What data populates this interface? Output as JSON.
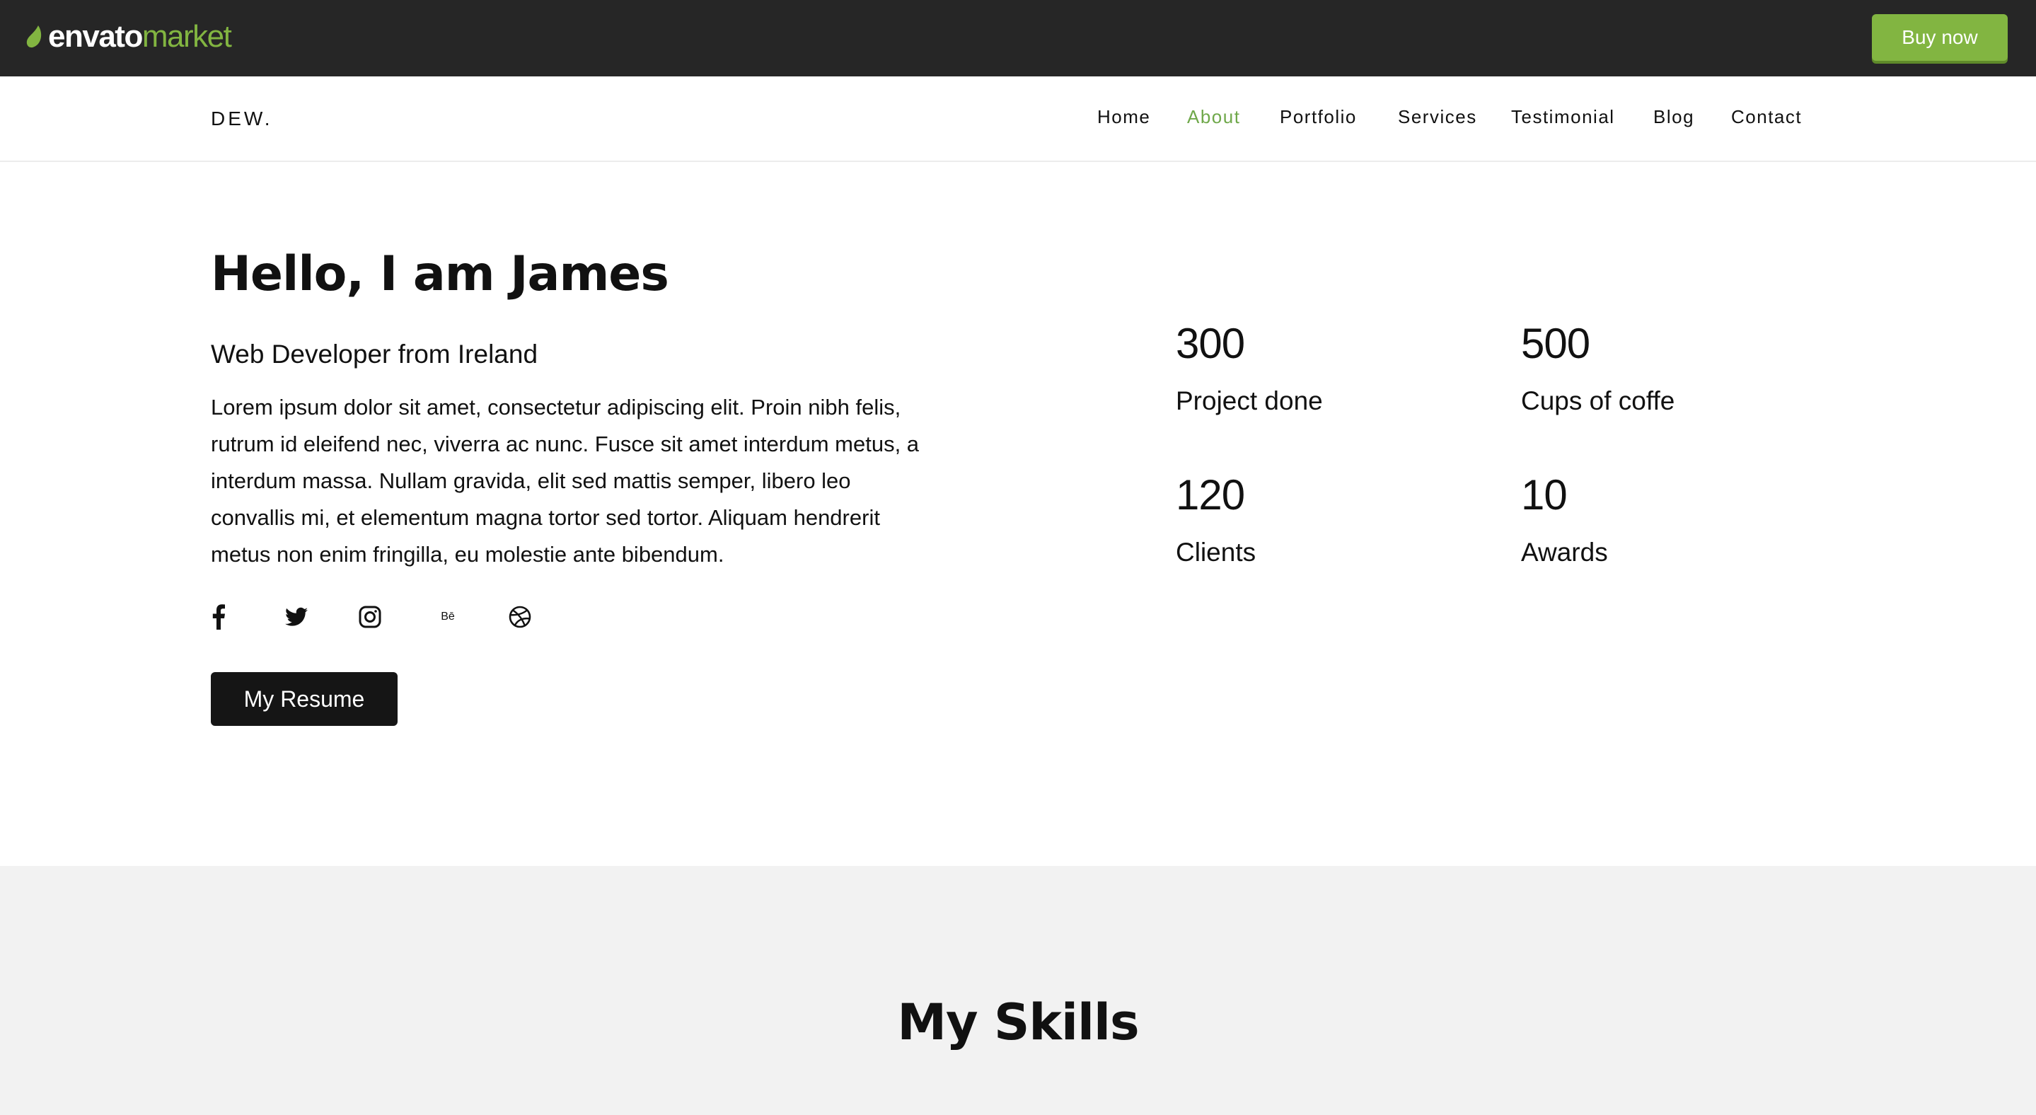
{
  "envato_bar": {
    "logo_word_1": "envato",
    "logo_word_2": "market",
    "buy_label": "Buy now",
    "accent": "#82b541",
    "background": "#262626"
  },
  "navbar": {
    "brand": "DEW.",
    "active_color": "#6fa84a",
    "items": [
      {
        "label": "Home",
        "active": false
      },
      {
        "label": "About",
        "active": true
      },
      {
        "label": "Portfolio",
        "active": false
      },
      {
        "label": "Services",
        "active": false
      },
      {
        "label": "Testimonial",
        "active": false
      },
      {
        "label": "Blog",
        "active": false
      },
      {
        "label": "Contact",
        "active": false
      }
    ]
  },
  "hero": {
    "title": "Hello, I am James",
    "subtitle": "Web Developer from Ireland",
    "lines": [
      "Lorem ipsum dolor sit amet, consectetur adipiscing elit. Proin nibh felis,",
      "rutrum id eleifend nec, viverra ac nunc. Fusce sit amet interdum metus, a",
      "interdum massa. Nullam gravida, elit sed mattis semper, libero leo",
      "convallis mi, et elementum magna tortor sed tortor. Aliquam hendrerit",
      "metus non enim fringilla, eu molestie ante bibendum."
    ],
    "social_icons": [
      "facebook-icon",
      "twitter-icon",
      "instagram-icon",
      "behance-icon",
      "dribbble-icon"
    ],
    "behance_glyph": "Bē",
    "resume_label": "My Resume"
  },
  "stats": [
    {
      "value": "300",
      "label": "Project done"
    },
    {
      "value": "500",
      "label": "Cups of coffe"
    },
    {
      "value": "120",
      "label": "Clients"
    },
    {
      "value": "10",
      "label": "Awards"
    }
  ],
  "skills": {
    "title": "My Skills"
  }
}
